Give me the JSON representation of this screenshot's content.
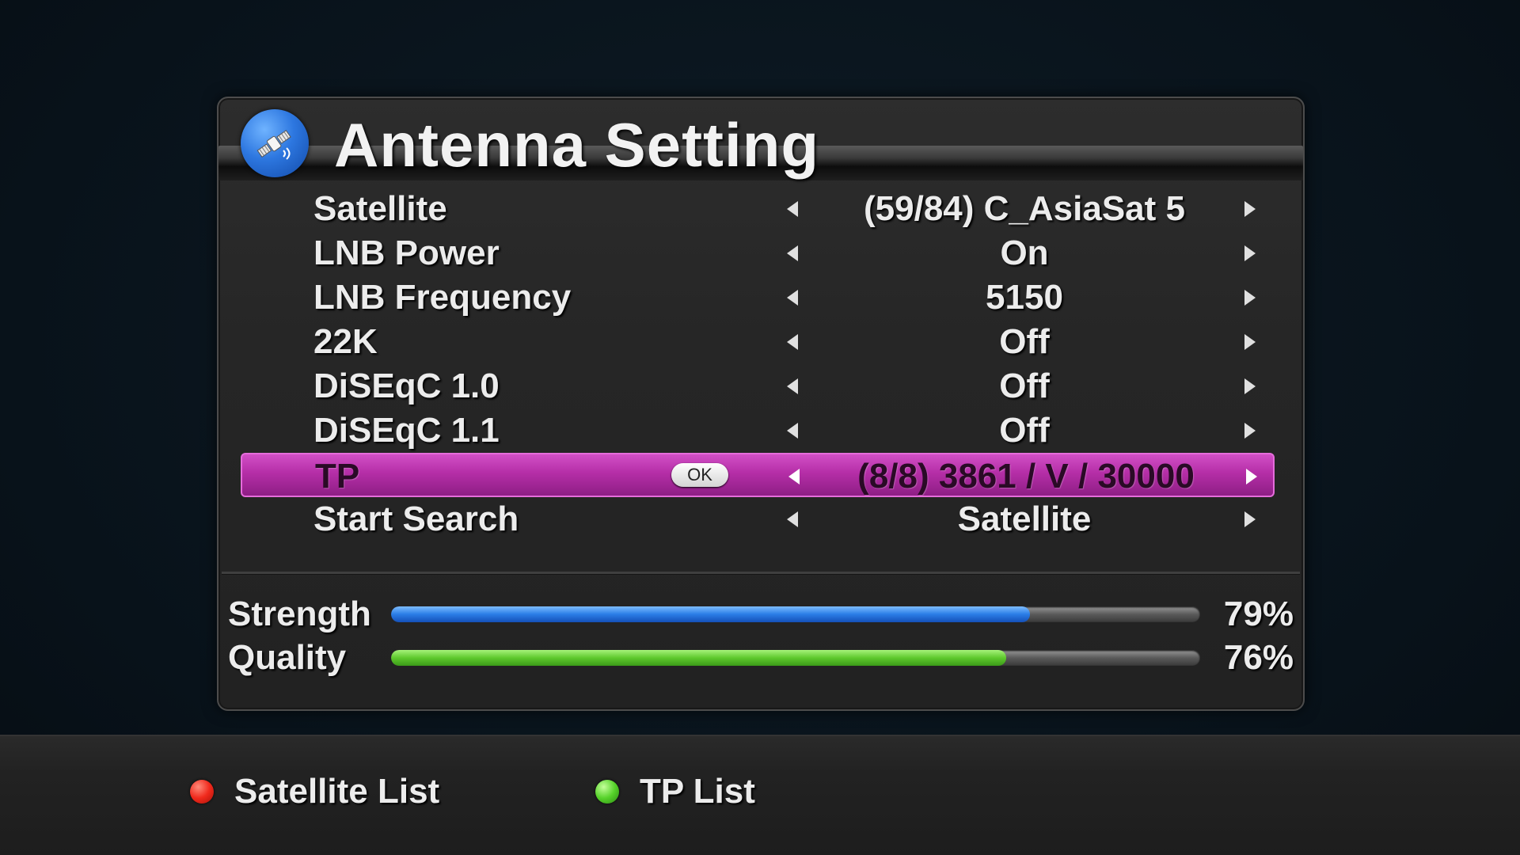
{
  "window": {
    "title": "Antenna Setting",
    "icon": "satellite-icon"
  },
  "settings": [
    {
      "label": "Satellite",
      "value": "(59/84) C_AsiaSat 5",
      "selected": false
    },
    {
      "label": "LNB Power",
      "value": "On",
      "selected": false
    },
    {
      "label": "LNB Frequency",
      "value": "5150",
      "selected": false
    },
    {
      "label": "22K",
      "value": "Off",
      "selected": false
    },
    {
      "label": "DiSEqC 1.0",
      "value": "Off",
      "selected": false
    },
    {
      "label": "DiSEqC 1.1",
      "value": "Off",
      "selected": false
    },
    {
      "label": "TP",
      "value": "(8/8) 3861 / V / 30000",
      "selected": true,
      "badge": "OK"
    },
    {
      "label": "Start Search",
      "value": "Satellite",
      "selected": false
    }
  ],
  "signal": {
    "strength": {
      "label": "Strength",
      "percent": 79,
      "text": "79%",
      "color": "#2a7de6"
    },
    "quality": {
      "label": "Quality",
      "percent": 76,
      "text": "76%",
      "color": "#5ec92d"
    }
  },
  "colors": {
    "selected_row": "#b52ea7",
    "red_key": "#f0291c",
    "green_key": "#56d22a"
  },
  "footer": {
    "red_key_label": "Satellite List",
    "green_key_label": "TP List"
  }
}
